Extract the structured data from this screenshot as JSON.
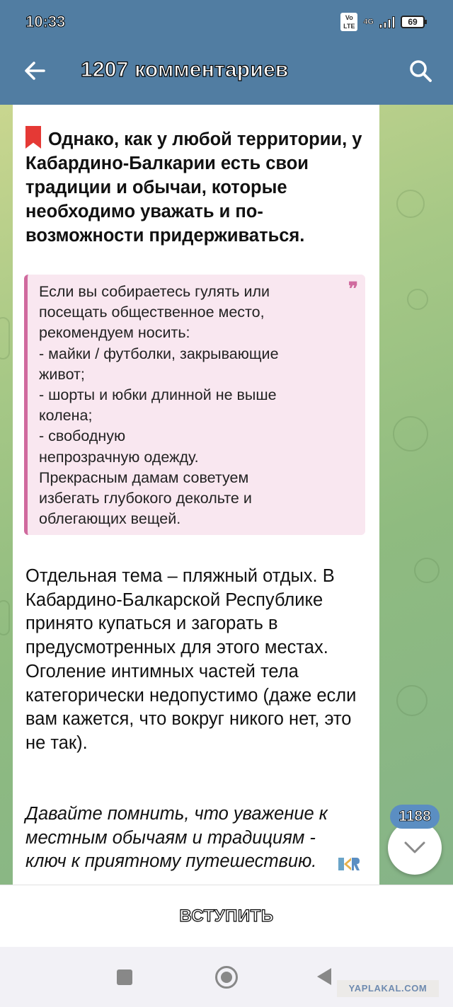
{
  "status_bar": {
    "time": "10:33",
    "volte_label": "Vo LTE",
    "network_label": "4G",
    "battery_level": "69"
  },
  "header": {
    "title": "1207 комментариев"
  },
  "message": {
    "lead_text": "Однако, как у любой территории, у Кабардино-Балкарии есть свои традиции и обычаи, которые необходимо уважать и по-возможности придерживаться.",
    "quote_text": "Если вы собираетесь гулять или\nпосещать общественное место,\nрекомендуем носить:\n- майки / футболки, закрывающие\nживот;\n- шорты и юбки длинной не выше\nколена;\n- свободную\nнепрозрачную одежду.\nПрекрасным дамам советуем\nизбегать глубокого декольте и\nоблегающих вещей.",
    "body_text": "Отдельная тема – пляжный отдых. В Кабардино-Балкарской Республике принято купаться и загорать в предусмотренных для этого местах. Оголение интимных частей тела категорически недопустимо (даже если вам кажется, что вокруг никого нет, это не так).",
    "closing_text": "Давайте помнить, что уважение к местным обычаям и традициям - ключ к приятному путешествию."
  },
  "unread_count": "1188",
  "join_label": "ВСТУПИТЬ",
  "watermark": "YAPLAKAL.COM",
  "colors": {
    "header_bg": "#517da2",
    "quote_accent": "#d06a9e",
    "quote_bg": "#f9e7f0",
    "badge_bg": "#5b8ec2"
  },
  "icons": {
    "back": "arrow-left-icon",
    "search": "search-icon",
    "bookmark": "bookmark-icon",
    "quote": "quote-icon",
    "scroll_down": "chevron-down-icon"
  }
}
